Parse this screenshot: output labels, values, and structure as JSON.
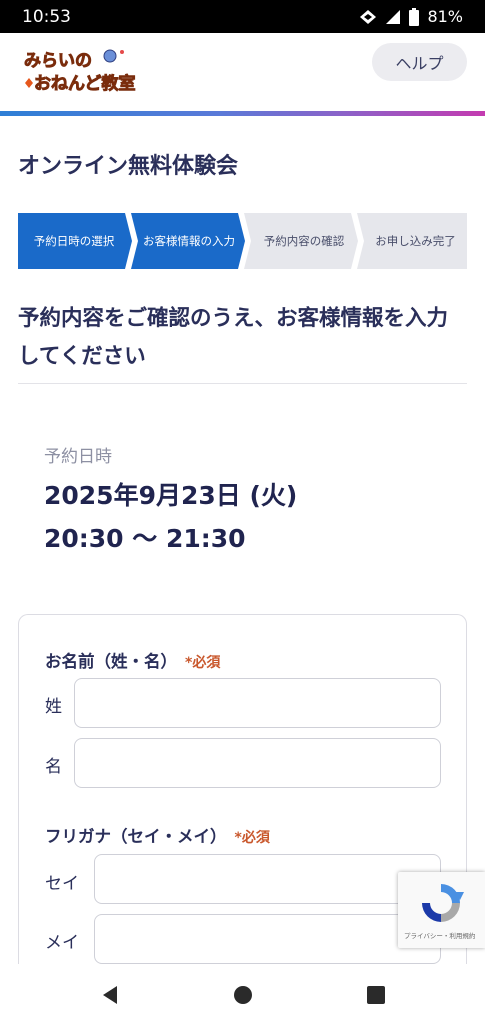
{
  "status_bar": {
    "time": "10:53",
    "battery": "81%"
  },
  "header": {
    "logo_text": "みらいのおねんど教室",
    "help_label": "ヘルプ"
  },
  "page_title": "オンライン無料体験会",
  "steps": [
    {
      "label": "予約日時の選択",
      "state": "active"
    },
    {
      "label": "お客様情報の入力",
      "state": "active"
    },
    {
      "label": "予約内容の確認",
      "state": "inactive"
    },
    {
      "label": "お申し込み完了",
      "state": "inactive"
    }
  ],
  "lead_text": "予約内容をご確認のうえ、お客様情報を入力してください",
  "reservation": {
    "label": "予約日時",
    "date": "2025年9月23日 (火)",
    "time": "20:30 〜 21:30"
  },
  "form": {
    "name": {
      "title": "お名前（姓・名）",
      "required": "*必須",
      "last_label": "姓",
      "last_value": "",
      "first_label": "名",
      "first_value": ""
    },
    "kana": {
      "title": "フリガナ（セイ・メイ）",
      "required": "*必須",
      "last_label": "セイ",
      "last_value": "",
      "first_label": "メイ",
      "first_value": ""
    }
  },
  "recaptcha": {
    "text": "プライバシー・利用規約"
  },
  "colors": {
    "step_active": "#1a6ac9",
    "step_inactive": "#e6e7ec",
    "required": "#c9582d",
    "heading": "#2a2f5a"
  }
}
